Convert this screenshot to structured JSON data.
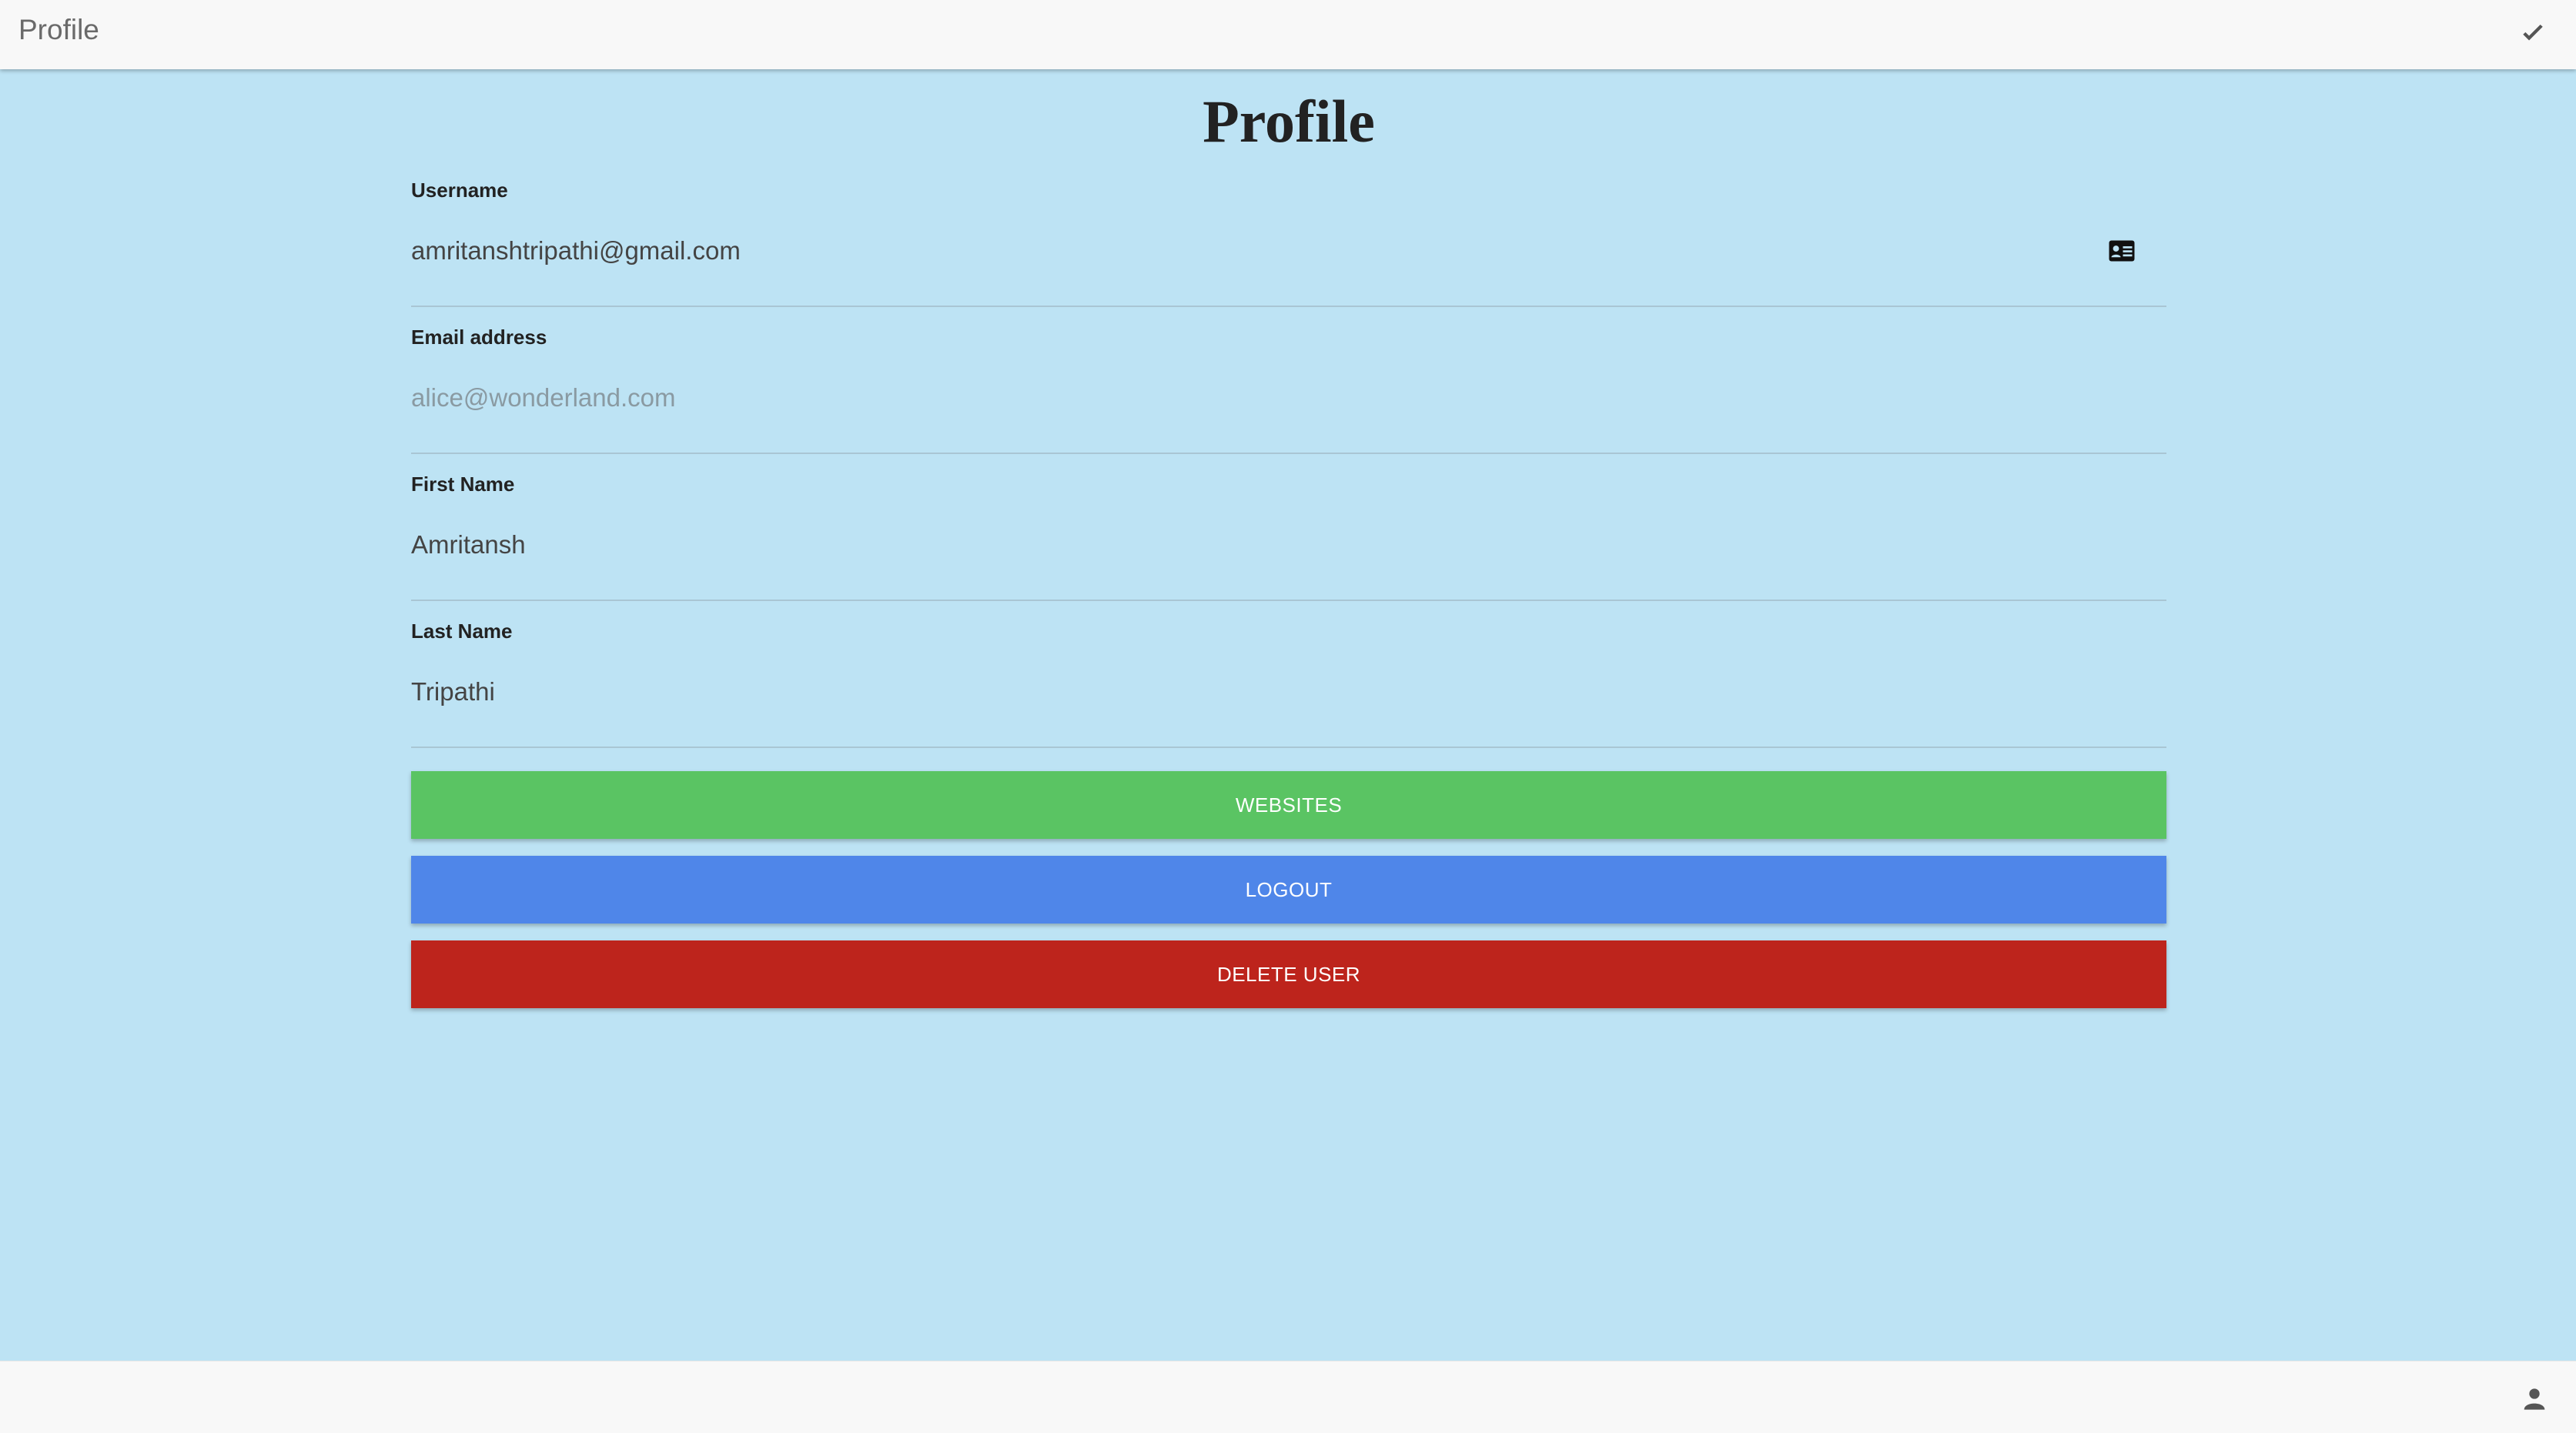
{
  "header": {
    "title": "Profile",
    "confirm_icon": "check-icon"
  },
  "page": {
    "title": "Profile"
  },
  "form": {
    "username": {
      "label": "Username",
      "value": "amritanshtripathi@gmail.com",
      "icon": "id-card-icon"
    },
    "email": {
      "label": "Email address",
      "value": "",
      "placeholder": "alice@wonderland.com"
    },
    "first_name": {
      "label": "First Name",
      "value": "Amritansh"
    },
    "last_name": {
      "label": "Last Name",
      "value": "Tripathi"
    }
  },
  "buttons": {
    "websites": "WEBSITES",
    "logout": "LOGOUT",
    "delete_user": "DELETE USER"
  },
  "footer": {
    "user_icon": "user-icon"
  },
  "colors": {
    "background": "#bde3f4",
    "bar": "#f8f8f8",
    "websites": "#5ac463",
    "logout": "#4f86e9",
    "delete": "#bd241c"
  }
}
